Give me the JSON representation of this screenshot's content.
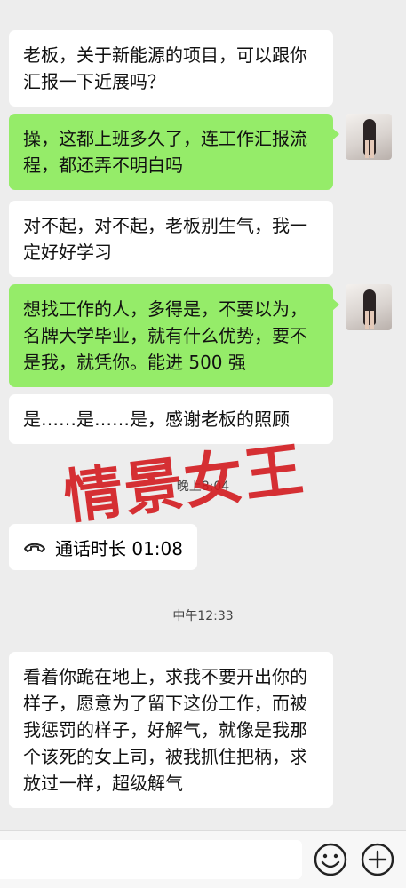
{
  "messages": [
    {
      "side": "left",
      "text": "老板，关于新能源的项目，可以跟你汇报一下近展吗？"
    },
    {
      "side": "right",
      "text": "操，这都上班多久了，连工作汇报流程，都还弄不明白吗"
    },
    {
      "side": "left",
      "text": "对不起，对不起，老板别生气，我一定好好学习"
    },
    {
      "side": "right",
      "text": "想找工作的人，多得是，不要以为，名牌大学毕业，就有什么优势，要不是我，就凭你。能进 500 强"
    },
    {
      "side": "left",
      "text": "是……是……是，感谢老板的照顾"
    },
    {
      "side": "left",
      "text": "看着你跪在地上，求我不要开出你的样子，愿意为了留下这份工作，而被我惩罚的样子，好解气，就像是我那个该死的女上司，被我抓住把柄，求放过一样，超级解气"
    }
  ],
  "times": [
    "晚上8:04",
    "中午12:33"
  ],
  "call": {
    "label": "通话时长 01:08",
    "icon": "phone-hangup-icon"
  },
  "watermark": "情景女王",
  "input_bar": {
    "emoji_icon": "emoji-icon",
    "add_icon": "plus-circle-icon"
  }
}
